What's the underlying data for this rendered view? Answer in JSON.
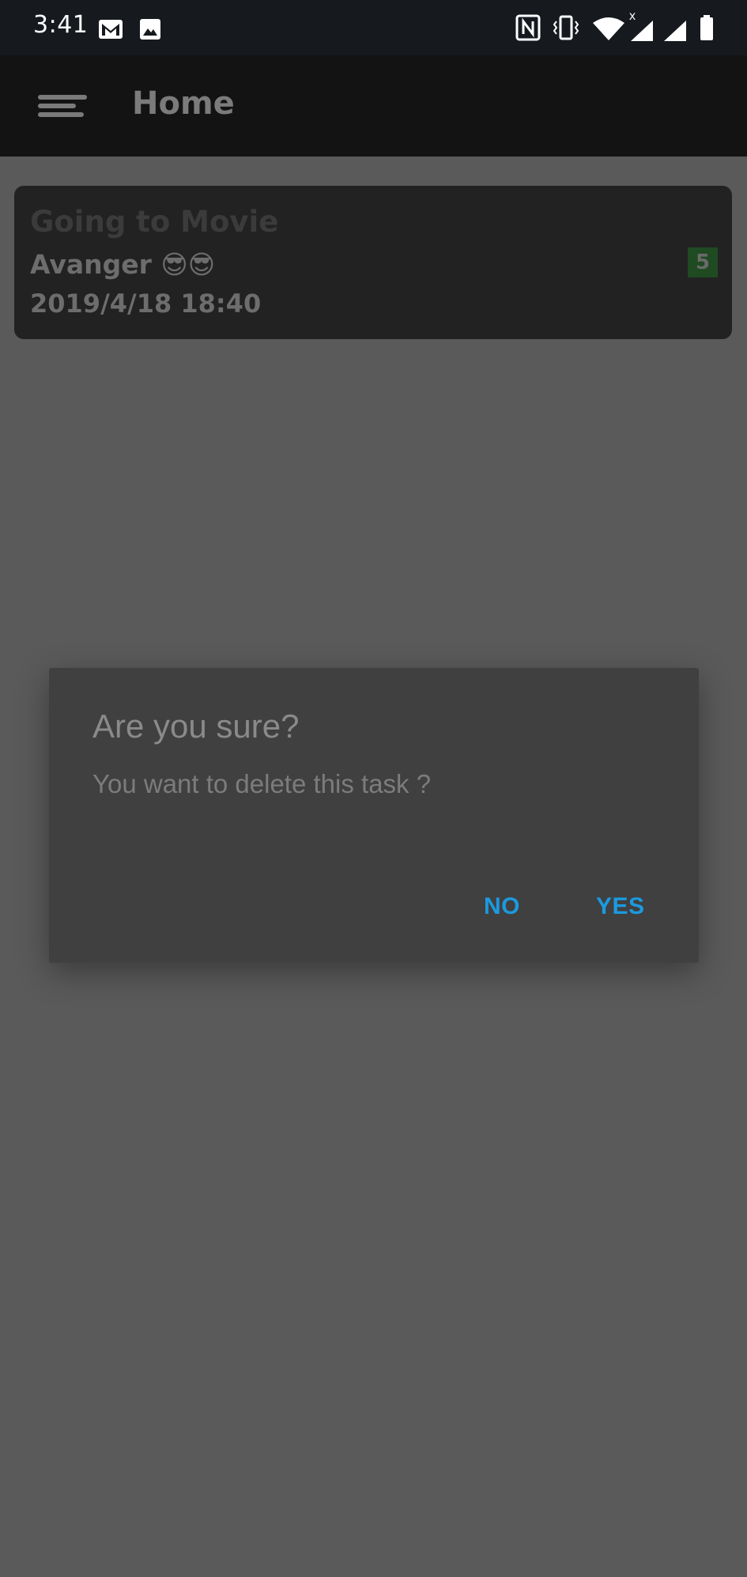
{
  "status_bar": {
    "time": "3:41",
    "icons": [
      "gmail-icon",
      "image-icon",
      "nfc-icon",
      "vibrate-icon",
      "wifi-icon",
      "signal-icon",
      "signal-icon-2",
      "battery-icon"
    ],
    "wifi_tag": "x"
  },
  "app_bar": {
    "title": "Home",
    "menu_icon": "menu-icon"
  },
  "task_card": {
    "title": "Going to Movie",
    "description": "Avanger 😎😎",
    "datetime": "2019/4/18 18:40",
    "badge": "5"
  },
  "dialog": {
    "title": "Are you sure?",
    "message": "You want to delete this task ?",
    "no_label": "NO",
    "yes_label": "YES"
  },
  "colors": {
    "scrim": "#5a5a5a",
    "dialog_bg": "#404040",
    "button_accent": "#1b9ae0",
    "badge_bg": "#1f4a22"
  }
}
